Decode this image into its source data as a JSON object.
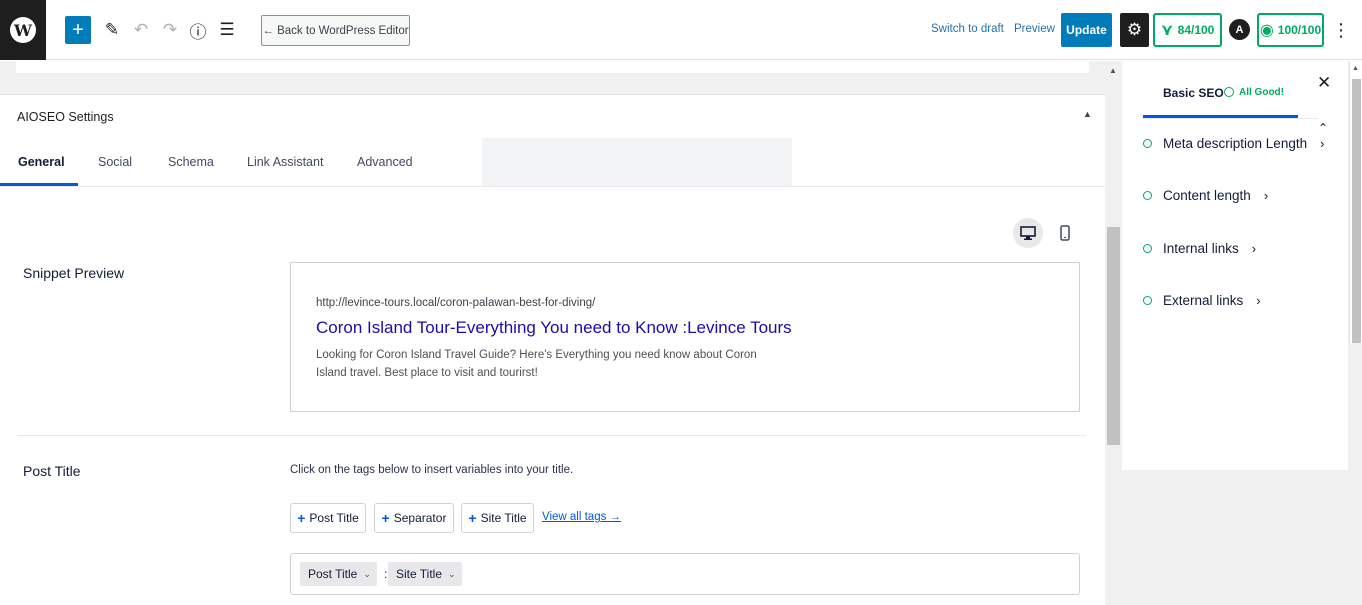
{
  "toolbar": {
    "back_label": "← Back to WordPress Editor",
    "switch_to_draft": "Switch to draft",
    "preview": "Preview",
    "update": "Update",
    "score_1": "84/100",
    "score_2": "100/100"
  },
  "aioseo": {
    "section_title": "AIOSEO Settings",
    "tabs": [
      {
        "label": "General",
        "active": true
      },
      {
        "label": "Social"
      },
      {
        "label": "Schema"
      },
      {
        "label": "Link Assistant"
      },
      {
        "label": "Advanced"
      }
    ]
  },
  "snippet": {
    "label": "Snippet Preview",
    "url": "http://levince-tours.local/coron-palawan-best-for-diving/",
    "title": "Coron Island Tour-Everything You need to Know :Levince Tours",
    "description": "Looking for Coron Island Travel Guide? Here's Everything you need know about Coron Island travel. Best place to visit and tourirst!"
  },
  "post_title": {
    "label": "Post Title",
    "help": "Click on the tags below to insert variables into your title.",
    "tags": [
      "Post Title",
      "Separator",
      "Site Title"
    ],
    "view_all": "View all tags →",
    "chips": [
      "Post Title",
      "Site Title"
    ],
    "separator_char": ":"
  },
  "sidebar": {
    "tab": "Basic SEO",
    "status": "All Good!",
    "checks": [
      "Meta description Length",
      "Content length",
      "Internal links",
      "External links"
    ]
  },
  "colors": {
    "primary": "#007cba",
    "aioseo_blue": "#005ae0",
    "good_green": "#00aa63",
    "snippet_title": "#1a0dab"
  }
}
